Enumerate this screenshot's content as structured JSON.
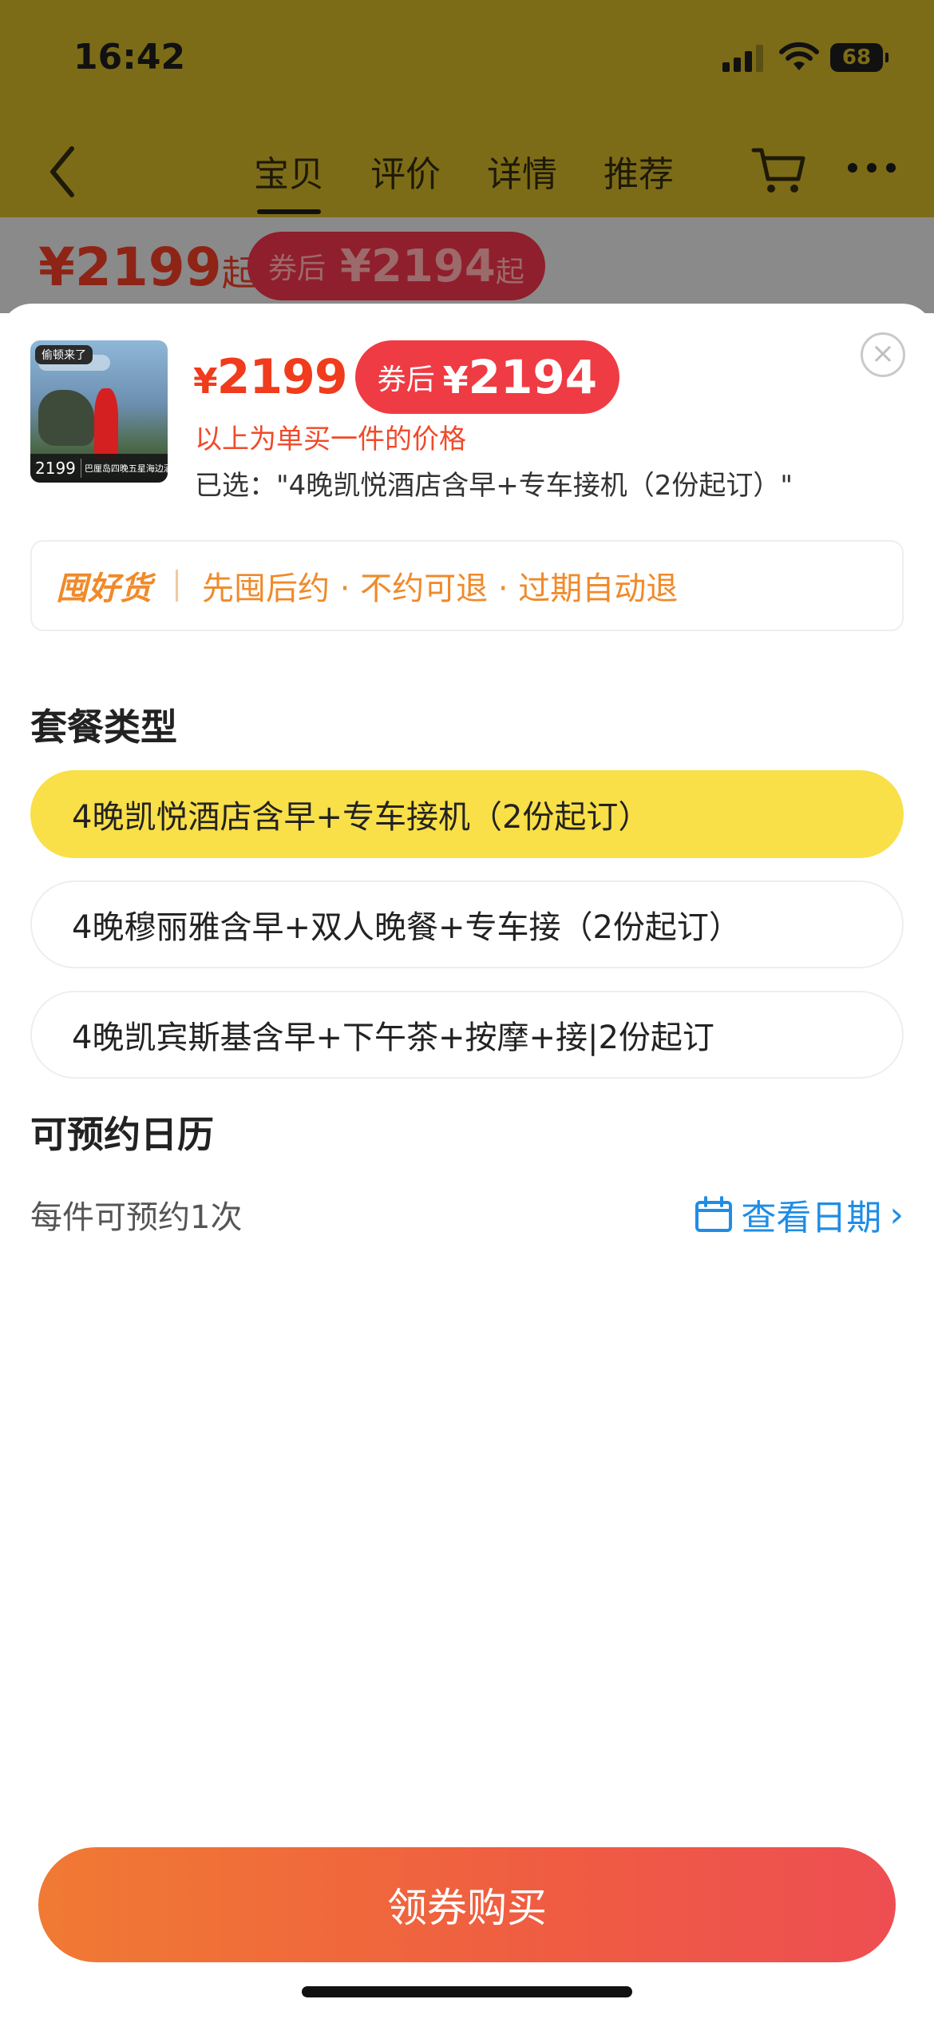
{
  "status": {
    "time": "16:42",
    "battery": "68"
  },
  "nav": {
    "tabs": [
      {
        "label": "宝贝",
        "active": true
      },
      {
        "label": "评价",
        "active": false
      },
      {
        "label": "详情",
        "active": false
      },
      {
        "label": "推荐",
        "active": false
      }
    ]
  },
  "bg_price": {
    "price": "¥2199",
    "suffix": "起",
    "coupon_label": "券后",
    "coupon_price": "¥2194",
    "coupon_suffix": "起"
  },
  "sheet": {
    "thumb": {
      "tag": "偷顿来了",
      "price": "2199",
      "caption": "巴厘岛四晚五星海边酒店"
    },
    "price_yen": "¥",
    "price": "2199",
    "coupon_label": "券后",
    "coupon_yen": "¥",
    "coupon_price": "2194",
    "single_note": "以上为单买一件的价格",
    "selected_text": "已选：\"4晚凯悦酒店含早+专车接机（2份起订）\"",
    "close_icon": "close-circle-icon",
    "guarantee": {
      "logo": "囤好货",
      "text": "先囤后约 · 不约可退 · 过期自动退"
    },
    "package_title": "套餐类型",
    "packages": [
      {
        "label": "4晚凯悦酒店含早+专车接机（2份起订）",
        "selected": true
      },
      {
        "label": "4晚穆丽雅含早+双人晚餐+专车接（2份起订）",
        "selected": false
      },
      {
        "label": "4晚凯宾斯基含早+下午茶+按摩+接|2份起订",
        "selected": false
      }
    ],
    "calendar_title": "可预约日历",
    "calendar_note": "每件可预约1次",
    "calendar_link": "查看日期",
    "buy_label": "领券购买"
  },
  "colors": {
    "accent_red": "#ef3b43",
    "price_red": "#f03b1d",
    "selected_yellow": "#f9df48",
    "link_blue": "#1f8de6",
    "guarantee_orange": "#f08a2a"
  }
}
